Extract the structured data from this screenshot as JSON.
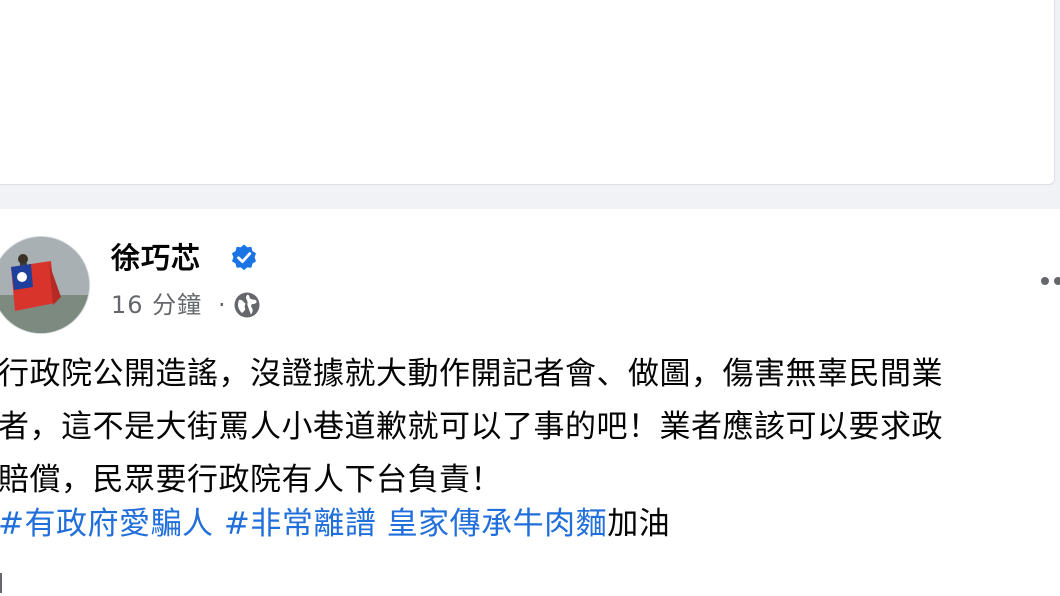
{
  "post": {
    "author": "徐巧芯",
    "time": "16 分鐘",
    "dot": "·",
    "body_lines": [
      "行政院公開造謠，沒證據就大動作開記者會、做圖，傷害無辜民間業",
      "者，這不是大街罵人小巷道歉就可以了事的吧！業者應該可以要求政",
      "賠償，民眾要行政院有人下台負責！"
    ],
    "hashtags": [
      "#有政府愛騙人",
      "#非常離譜",
      "皇家傳承牛肉麵"
    ],
    "hashtag_suffix": "加油",
    "icons": {
      "verified": "verified-badge-icon",
      "audience": "globe-icon",
      "more": "more-options-icon"
    }
  },
  "colors": {
    "page_background": "#f0f2f5",
    "card_background": "#ffffff",
    "link_blue": "#216fdb",
    "verified_blue": "#1b74e4",
    "secondary_text": "#65676b",
    "primary_text": "#050505"
  }
}
